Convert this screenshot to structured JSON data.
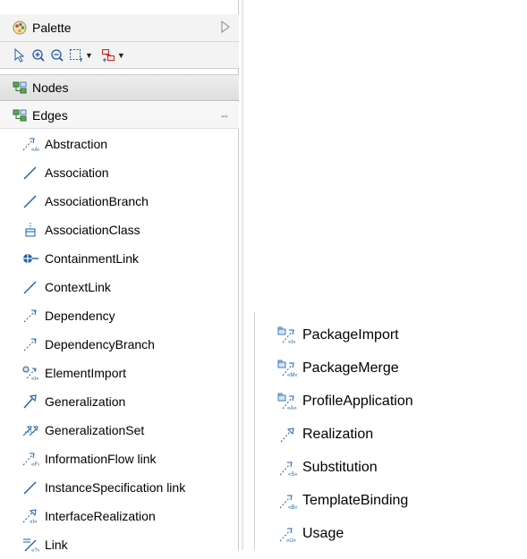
{
  "palette": {
    "title": "Palette",
    "collapse_icon": "collapse-triangle-icon",
    "toolbar": [
      {
        "name": "select-tool-icon"
      },
      {
        "name": "zoom-in-icon"
      },
      {
        "name": "zoom-out-icon"
      },
      {
        "name": "marquee-select-icon",
        "dropdown": true
      },
      {
        "name": "create-element-icon",
        "dropdown": true
      }
    ],
    "drawers": {
      "nodes": {
        "label": "Nodes",
        "expanded": false
      },
      "edges": {
        "label": "Edges",
        "expanded": true
      }
    },
    "edge_items": [
      {
        "label": "Abstraction",
        "icon": "abstraction-icon"
      },
      {
        "label": "Association",
        "icon": "association-icon"
      },
      {
        "label": "AssociationBranch",
        "icon": "association-branch-icon"
      },
      {
        "label": "AssociationClass",
        "icon": "association-class-icon"
      },
      {
        "label": "ContainmentLink",
        "icon": "containment-link-icon"
      },
      {
        "label": "ContextLink",
        "icon": "context-link-icon"
      },
      {
        "label": "Dependency",
        "icon": "dependency-icon"
      },
      {
        "label": "DependencyBranch",
        "icon": "dependency-branch-icon"
      },
      {
        "label": "ElementImport",
        "icon": "element-import-icon"
      },
      {
        "label": "Generalization",
        "icon": "generalization-icon"
      },
      {
        "label": "GeneralizationSet",
        "icon": "generalization-set-icon"
      },
      {
        "label": "InformationFlow link",
        "icon": "information-flow-icon"
      },
      {
        "label": "InstanceSpecification link",
        "icon": "instance-specification-icon"
      },
      {
        "label": "InterfaceRealization",
        "icon": "interface-realization-icon"
      },
      {
        "label": "Link",
        "icon": "link-icon"
      }
    ]
  },
  "overflow_list": [
    {
      "label": "PackageImport",
      "icon": "package-import-icon"
    },
    {
      "label": "PackageMerge",
      "icon": "package-merge-icon"
    },
    {
      "label": "ProfileApplication",
      "icon": "profile-application-icon"
    },
    {
      "label": "Realization",
      "icon": "realization-icon"
    },
    {
      "label": "Substitution",
      "icon": "substitution-icon"
    },
    {
      "label": "TemplateBinding",
      "icon": "template-binding-icon"
    },
    {
      "label": "Usage",
      "icon": "usage-icon"
    }
  ],
  "colors": {
    "link_blue": "#1f5fa8",
    "header_bg": "#f3f3f3",
    "border": "#c9c9c9"
  }
}
